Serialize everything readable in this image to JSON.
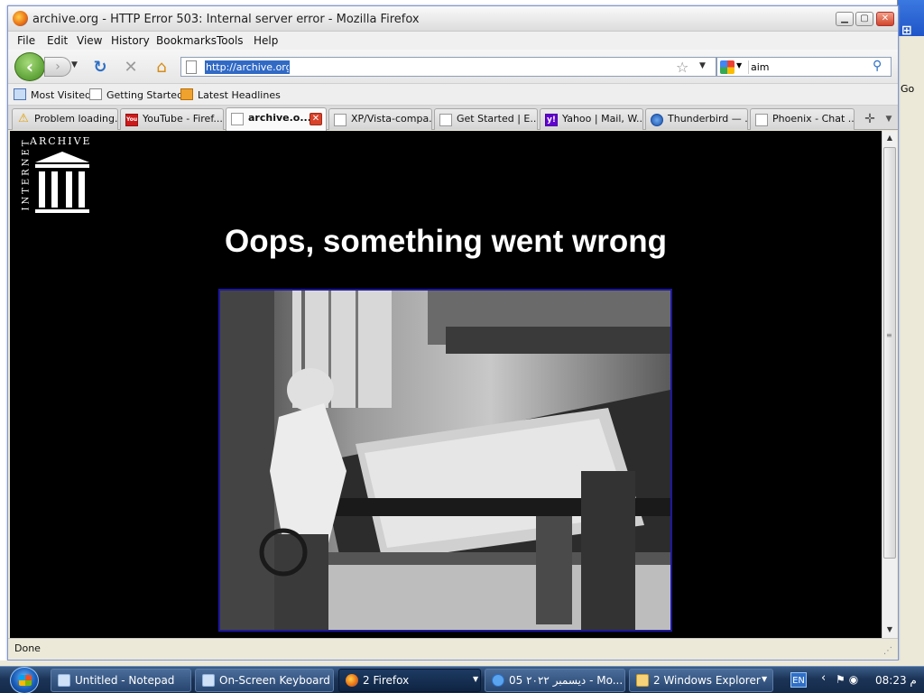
{
  "window": {
    "title": "archive.org - HTTP Error 503: Internal server error - Mozilla Firefox",
    "min_glyph": "▁",
    "max_glyph": "▢",
    "close_glyph": "✕"
  },
  "menu": [
    "File",
    "Edit",
    "View",
    "History",
    "Bookmarks",
    "Tools",
    "Help"
  ],
  "nav": {
    "back_glyph": "‹",
    "forward_glyph": "›",
    "reload_glyph": "↻",
    "stop_glyph": "✕",
    "home_glyph": "⌂",
    "url": "http://archive.org/",
    "search_query": "aim"
  },
  "bookmarks": [
    "Most Visited",
    "Getting Started",
    "Latest Headlines"
  ],
  "tabs": [
    {
      "label": "Problem loading...",
      "icon": "warning-icon",
      "active": false
    },
    {
      "label": "YouTube - Firef...",
      "icon": "youtube-icon",
      "active": false
    },
    {
      "label": "archive.o...",
      "icon": "page-icon",
      "active": true
    },
    {
      "label": "XP/Vista-compa...",
      "icon": "page-icon",
      "active": false
    },
    {
      "label": "Get Started | E...",
      "icon": "page-icon",
      "active": false
    },
    {
      "label": "Yahoo | Mail, W...",
      "icon": "yahoo-icon",
      "active": false
    },
    {
      "label": "Thunderbird — ...",
      "icon": "thunderbird-icon",
      "active": false
    },
    {
      "label": "Phoenix - Chat ...",
      "icon": "page-icon",
      "active": false
    }
  ],
  "page": {
    "logo_top": "ARCHIVE",
    "logo_side": "INTERNET",
    "heading": "Oops, something went wrong"
  },
  "status": {
    "text": "Done"
  },
  "background_window": {
    "go_label": "Go"
  },
  "taskbar": {
    "items": [
      {
        "label": "Untitled - Notepad",
        "icon": "notepad-icon"
      },
      {
        "label": "On-Screen Keyboard",
        "icon": "keyboard-icon"
      },
      {
        "label": "2 Firefox",
        "icon": "firefox-icon"
      },
      {
        "label": "05 ديسمبر ٢٠٢٢ - Mo...",
        "icon": "ie-icon"
      },
      {
        "label": "2 Windows Explorer",
        "icon": "folder-icon"
      }
    ],
    "language": "EN",
    "clock": "08:23 م"
  },
  "colors": {
    "page_background": "#000000",
    "photo_border": "#1d18a0",
    "url_selection": "#316ac5",
    "taskbar": "#1c3457"
  }
}
